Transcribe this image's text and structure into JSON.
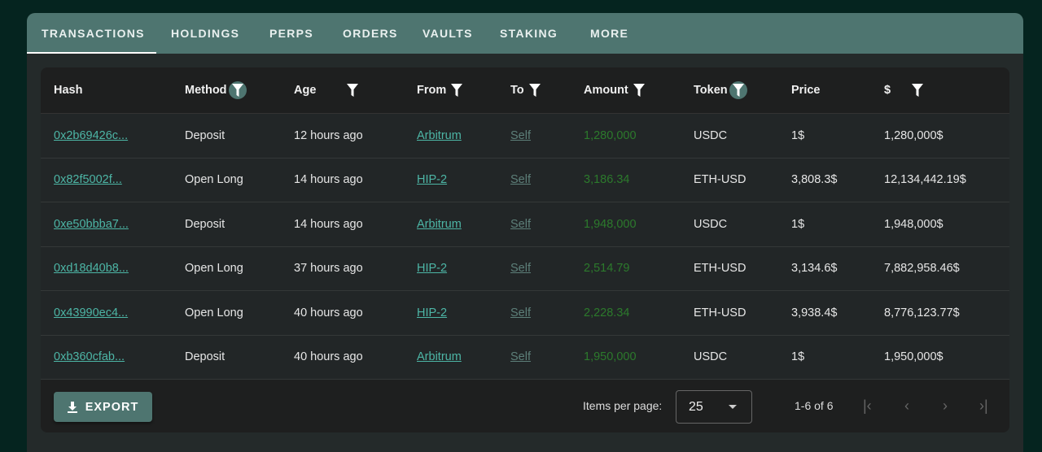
{
  "tabs": [
    "TRANSACTIONS",
    "HOLDINGS",
    "PERPS",
    "ORDERS",
    "VAULTS",
    "STAKING",
    "MORE"
  ],
  "columns": [
    "Hash",
    "Method",
    "Age",
    "From",
    "To",
    "Amount",
    "Token",
    "Price",
    "$"
  ],
  "rows": [
    [
      "0x2b69426c...",
      "Deposit",
      "12 hours ago",
      "Arbitrum",
      "Self",
      "1,280,000",
      "USDC",
      "1$",
      "1,280,000$"
    ],
    [
      "0x82f5002f...",
      "Open Long",
      "14 hours ago",
      "HIP-2",
      "Self",
      "3,186.34",
      "ETH-USD",
      "3,808.3$",
      "12,134,442.19$"
    ],
    [
      "0xe50bbba7...",
      "Deposit",
      "14 hours ago",
      "Arbitrum",
      "Self",
      "1,948,000",
      "USDC",
      "1$",
      "1,948,000$"
    ],
    [
      "0xd18d40b8...",
      "Open Long",
      "37 hours ago",
      "HIP-2",
      "Self",
      "2,514.79",
      "ETH-USD",
      "3,134.6$",
      "7,882,958.46$"
    ],
    [
      "0x43990ec4...",
      "Open Long",
      "40 hours ago",
      "HIP-2",
      "Self",
      "2,228.34",
      "ETH-USD",
      "3,938.4$",
      "8,776,123.77$"
    ],
    [
      "0xb360cfab...",
      "Deposit",
      "40 hours ago",
      "Arbitrum",
      "Self",
      "1,950,000",
      "USDC",
      "1$",
      "1,950,000$"
    ]
  ],
  "footer": {
    "export": "EXPORT",
    "items_per_page_label": "Items per page:",
    "items_per_page": "25",
    "range": "1-6 of 6"
  }
}
